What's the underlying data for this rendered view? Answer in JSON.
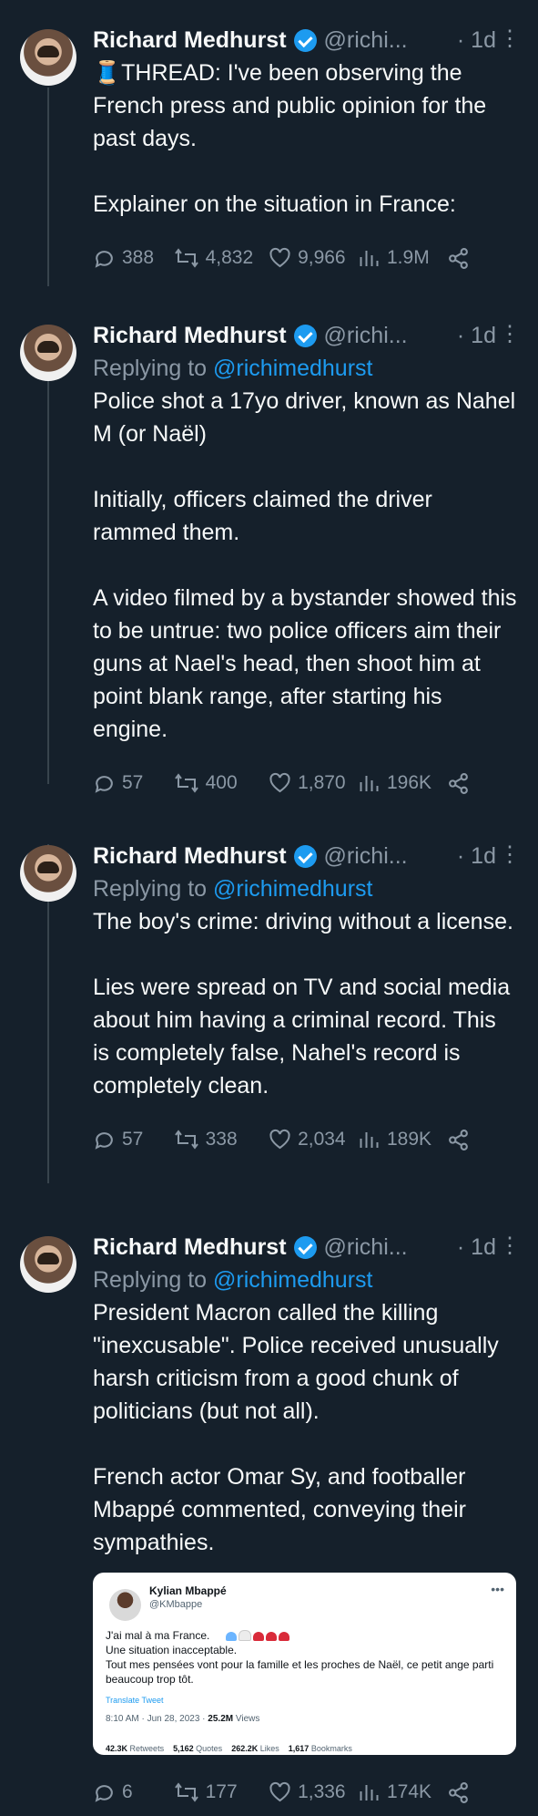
{
  "thread": [
    {
      "author": "Richard Medhurst",
      "handle": "@richi...",
      "time": "· 1d",
      "replying": false,
      "text": "🧵THREAD: I've been observing the French press and public opinion for the past days.\n\nExplainer on the situation in France:",
      "stats": {
        "replies": "388",
        "retweets": "4,832",
        "likes": "9,966",
        "views": "1.9M"
      }
    },
    {
      "author": "Richard Medhurst",
      "handle": "@richi...",
      "time": "· 1d",
      "replying": true,
      "reply_prefix": "Replying to",
      "reply_to": "@richimedhurst",
      "text": "Police shot a 17yo driver, known as Nahel M (or Naël)\n\nInitially, officers claimed the driver rammed them.\n\nA video filmed by a bystander showed this to be untrue: two police officers aim their guns at Nael's head, then shoot him at point blank range, after starting his engine.",
      "stats": {
        "replies": "57",
        "retweets": "400",
        "likes": "1,870",
        "views": "196K"
      }
    },
    {
      "author": "Richard Medhurst",
      "handle": "@richi...",
      "time": "· 1d",
      "replying": true,
      "reply_prefix": "Replying to",
      "reply_to": "@richimedhurst",
      "text": "The boy's crime: driving without a license.\n\nLies were spread on TV and social media about him having a criminal record. This is completely false, Nahel's record is completely clean.",
      "stats": {
        "replies": "57",
        "retweets": "338",
        "likes": "2,034",
        "views": "189K"
      }
    },
    {
      "author": "Richard Medhurst",
      "handle": "@richi...",
      "time": "· 1d",
      "replying": true,
      "reply_prefix": "Replying to",
      "reply_to": "@richimedhurst",
      "text": "President Macron called the killing \"inexcusable\". Police received unusually harsh criticism from a good chunk of politicians (but not all).\n\nFrench actor Omar Sy, and footballer Mbappé commented, conveying their sympathies.",
      "stats": {
        "replies": "6",
        "retweets": "177",
        "likes": "1,336",
        "views": "174K"
      },
      "embed": {
        "name": "Kylian Mbappé",
        "handle": "@KMbappe",
        "text": "J'ai mal à ma France.\nUne situation inacceptable.\nTout mes pensées vont pour la famille et les proches de Naël, ce petit ange parti beaucoup trop tôt.",
        "translate": "Translate Tweet",
        "time": "8:10 AM · Jun 28, 2023 ·",
        "views": "25.2M",
        "views_label": "Views",
        "retweets": "42.3K",
        "retweets_label": "Retweets",
        "quotes": "5,162",
        "quotes_label": "Quotes",
        "likes": "262.2K",
        "likes_label": "Likes",
        "bookmarks": "1,617",
        "bookmarks_label": "Bookmarks"
      }
    }
  ],
  "colors": {
    "background": "#15202b",
    "text": "#f7f9f9",
    "muted": "#8b98a5",
    "accent": "#1d9bf0"
  }
}
